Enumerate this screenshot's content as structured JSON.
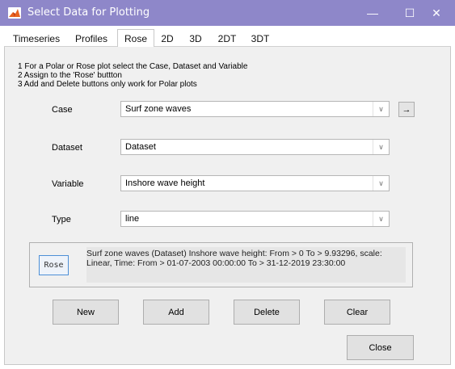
{
  "window": {
    "title": "Select Data for Plotting",
    "min_glyph": "—",
    "max_glyph": "☐",
    "close_glyph": "✕"
  },
  "tabs": [
    {
      "label": "Timeseries"
    },
    {
      "label": "Profiles"
    },
    {
      "label": "Rose",
      "active": true
    },
    {
      "label": "2D"
    },
    {
      "label": "3D"
    },
    {
      "label": "2DT"
    },
    {
      "label": "3DT"
    }
  ],
  "instructions": [
    "1 For a Polar or Rose plot select the Case, Dataset and Variable",
    "2 Assign to the 'Rose' buttton",
    "3 Add and Delete buttons only work for Polar plots"
  ],
  "fields": {
    "case": {
      "label": "Case",
      "value": "Surf zone waves"
    },
    "dataset": {
      "label": "Dataset",
      "value": "Dataset"
    },
    "variable": {
      "label": "Variable",
      "value": "Inshore wave height"
    },
    "type": {
      "label": "Type",
      "value": "line"
    }
  },
  "dropdown_arrow": "∨",
  "case_side_button": "→",
  "rose_button": "Rose",
  "selection_description": "Surf zone waves (Dataset) Inshore wave height: From > 0 To > 9.93296, scale: Linear, Time: From > 01-07-2003 00:00:00 To > 31-12-2019 23:30:00",
  "buttons": {
    "new": "New",
    "add": "Add",
    "delete": "Delete",
    "clear": "Clear",
    "close": "Close"
  },
  "colors": {
    "title_bar": "#8e87c9",
    "panel": "#f0f0f0",
    "rose_button_border": "#4d8fd6"
  }
}
